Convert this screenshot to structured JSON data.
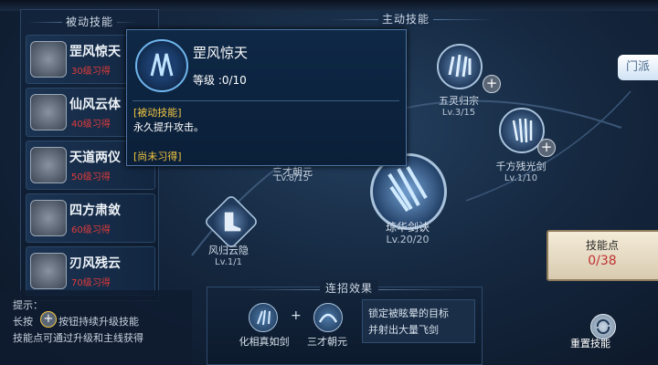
{
  "passive_section": {
    "title": "被动技能"
  },
  "active_section": {
    "title": "主动技能"
  },
  "passive_skills": [
    {
      "name": "罡风惊天",
      "req": "30级习得"
    },
    {
      "name": "仙风云体",
      "req": "40级习得"
    },
    {
      "name": "天道两仪",
      "req": "50级习得"
    },
    {
      "name": "四方肃敛",
      "req": "60级习得"
    },
    {
      "name": "刃风残云",
      "req": "70级习得"
    }
  ],
  "tooltip": {
    "name": "罡风惊天",
    "level_label": "等级 :0/10",
    "type_tag": "[被动技能]",
    "description": "永久提升攻击。",
    "status_tag": "[尚未习得]"
  },
  "active_skills": [
    {
      "name": "五灵归宗",
      "level": "Lv.3/15"
    },
    {
      "name": "千方残光剑",
      "level": "Lv.1/10"
    },
    {
      "name": "三才朝元",
      "level": "Lv.8/15"
    },
    {
      "name": "琼华剑诀",
      "level": "Lv.20/20"
    },
    {
      "name": "风归云隐",
      "level": "Lv.1/1"
    }
  ],
  "faction_tab": {
    "label": "门派"
  },
  "skill_points": {
    "label": "技能点",
    "value": "0/38"
  },
  "combo": {
    "title": "连招效果",
    "skill_a": "化相真如剑",
    "plus": "+",
    "skill_b": "三才朝元",
    "effect_line1": "锁定被眩晕的目标",
    "effect_line2": "并射出大量飞剑"
  },
  "hint": {
    "title": "提示：",
    "line1_pre": "长按",
    "line1_post": "按钮持续升级技能",
    "line2": "技能点可通过升级和主线获得"
  },
  "reset": {
    "label": "重置技能"
  },
  "icons": [
    "plus-icon",
    "sword-icon",
    "reset-icon",
    "boot-icon"
  ],
  "colors": {
    "accent": "#f3c640",
    "warning": "#e23c3c",
    "skill_points": "#c03232"
  }
}
